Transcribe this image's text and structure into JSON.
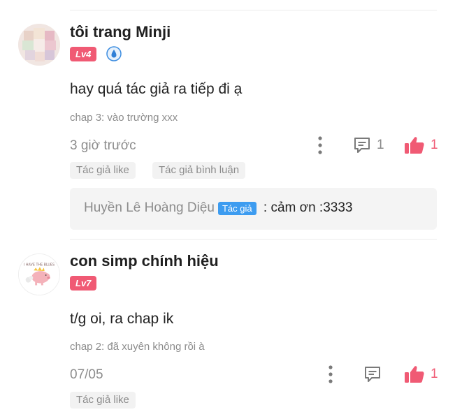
{
  "comments": [
    {
      "username": "tôi trang Minji",
      "level": "Lv4",
      "content": "hay quá tác giả ra tiếp đi ạ",
      "chapter": "chap 3: vào trường xxx",
      "time": "3 giờ trước",
      "reply_count": "1",
      "like_count": "1",
      "tags": [
        "Tác giả like",
        "Tác giả bình luận"
      ],
      "reply": {
        "author": "Huyền Lê Hoàng Diệu",
        "badge": "Tác giả",
        "separator": " : ",
        "text": "cảm ơn :3333"
      }
    },
    {
      "username": "con simp chính hiệu",
      "level": "Lv7",
      "content": "t/g oi, ra chap ik",
      "chapter": "chap 2: đã xuyên không rồi à",
      "time": "07/05",
      "like_count": "1",
      "tags": [
        "Tác giả like"
      ]
    }
  ],
  "colors": {
    "level_badge": "#f05a74",
    "like": "#f05a74",
    "author_badge": "#3d9cf0",
    "muted_text": "#8c8c8c"
  },
  "icons": [
    "more-vertical-icon",
    "comment-icon",
    "thumbs-up-icon",
    "water-drop-badge-icon"
  ]
}
